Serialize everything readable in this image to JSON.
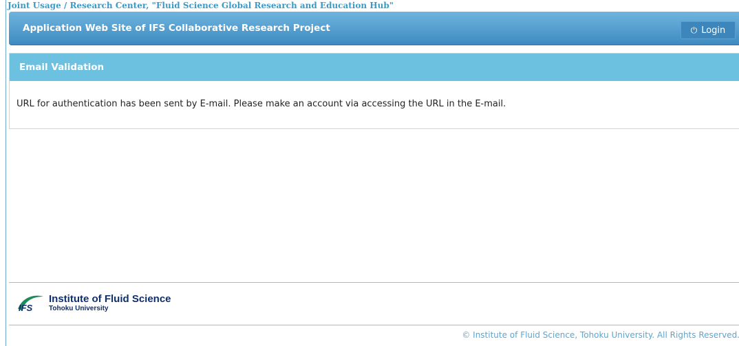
{
  "header": {
    "top_title": "Joint Usage / Research Center, \"Fluid Science Global Research and Education Hub\"",
    "app_title": "Application Web Site of IFS Collaborative Research Project",
    "login_label": "Login",
    "login_icon": "power-icon"
  },
  "panel": {
    "title": "Email Validation",
    "message": "URL for authentication has been sent by E-mail. Please make an account via accessing the URL in the E-mail."
  },
  "footer": {
    "logo_mark": "IFS",
    "logo_name": "Institute of Fluid Science",
    "logo_sub": "Tohoku University",
    "copyright": "© Institute of Fluid Science, Tohoku University. All Rights Reserved."
  },
  "colors": {
    "accent": "#3e8ac0",
    "panel_header": "#6cc0e0",
    "logo_navy": "#0f2e6e",
    "logo_green": "#1f8a5a"
  }
}
